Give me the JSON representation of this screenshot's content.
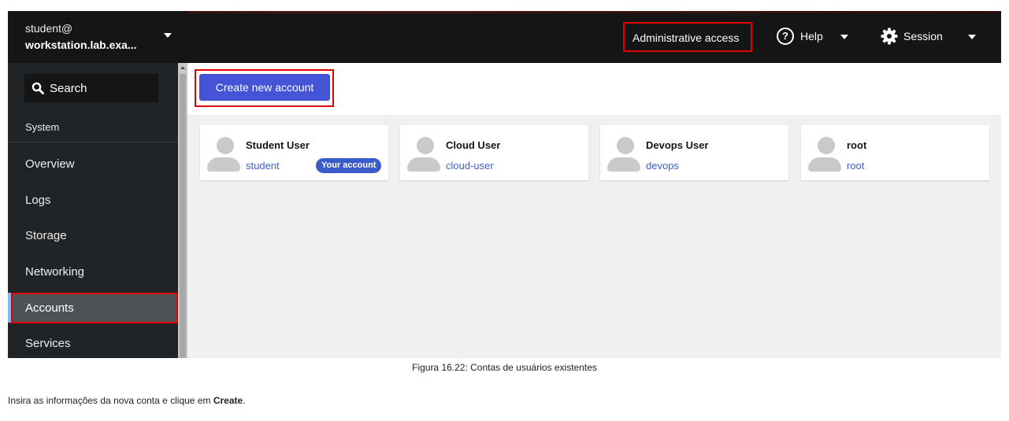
{
  "sidebar": {
    "host_line1": "student@",
    "host_line2": "workstation.lab.exa...",
    "search_label": "Search",
    "section_label": "System",
    "items": [
      {
        "label": "Overview"
      },
      {
        "label": "Logs"
      },
      {
        "label": "Storage"
      },
      {
        "label": "Networking"
      },
      {
        "label": "Accounts"
      },
      {
        "label": "Services"
      }
    ],
    "active_item": "Accounts"
  },
  "header": {
    "admin_label": "Administrative access",
    "help_label": "Help",
    "session_label": "Session"
  },
  "toolbar": {
    "create_label": "Create new account"
  },
  "accounts": [
    {
      "name": "Student User",
      "user": "student",
      "badge": "Your account"
    },
    {
      "name": "Cloud User",
      "user": "cloud-user"
    },
    {
      "name": "Devops User",
      "user": "devops"
    },
    {
      "name": "root",
      "user": "root"
    }
  ],
  "doc": {
    "caption": "Figura 16.22: Contas de usuários existentes",
    "instruction_prefix": "Insira as informações da nova conta e clique em ",
    "instruction_bold": "Create",
    "instruction_suffix": "."
  },
  "colors": {
    "sidebar_bg": "#212427",
    "header_bg": "#151515",
    "primary": "#4553d7",
    "link": "#3d62c7",
    "highlight": "#e00000",
    "active_accent": "#73bcf7"
  }
}
